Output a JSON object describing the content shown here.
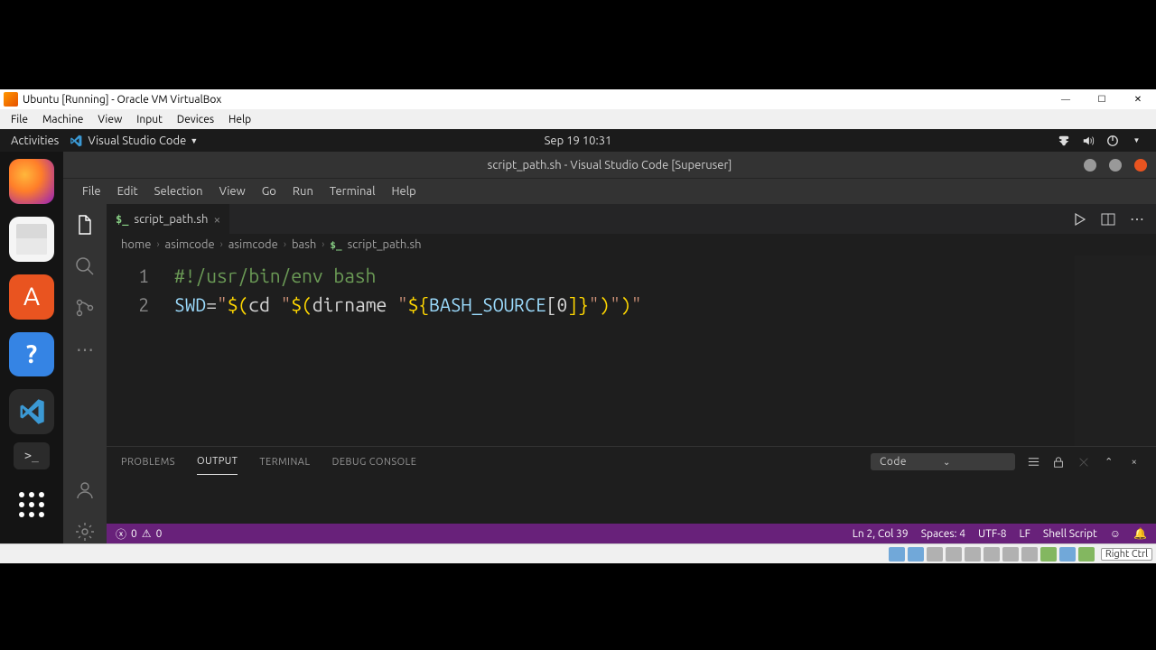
{
  "virtualbox": {
    "title": "Ubuntu [Running] - Oracle VM VirtualBox",
    "menu": [
      "File",
      "Machine",
      "View",
      "Input",
      "Devices",
      "Help"
    ],
    "hostkey": "Right Ctrl"
  },
  "gnome": {
    "activities": "Activities",
    "app_menu": "Visual Studio Code",
    "clock": "Sep 19  10:31"
  },
  "vscode": {
    "title": "script_path.sh - Visual Studio Code [Superuser]",
    "menu": [
      "File",
      "Edit",
      "Selection",
      "View",
      "Go",
      "Run",
      "Terminal",
      "Help"
    ],
    "tab": {
      "icon": "$_",
      "name": "script_path.sh"
    },
    "breadcrumb": [
      "home",
      "asimcode",
      "asimcode",
      "bash",
      "script_path.sh"
    ],
    "lines": {
      "l1": "#!/usr/bin/env bash",
      "l2_var": "SWD",
      "l2_eq": "=",
      "l2_q1": "\"",
      "l2_d1": "$(",
      "l2_cd": "cd ",
      "l2_q2": "\"",
      "l2_d2": "$(",
      "l2_dir": "dirname ",
      "l2_q3": "\"",
      "l2_bs1": "${",
      "l2_bs2": "BASH_SOURCE",
      "l2_bs3": "[",
      "l2_bs4": "0",
      "l2_bs5": "]}",
      "l2_q4": "\"",
      "l2_c1": ")",
      "l2_q5": "\"",
      "l2_c2": ")",
      "l2_q6": "\""
    },
    "panel": {
      "tabs": [
        "PROBLEMS",
        "OUTPUT",
        "TERMINAL",
        "DEBUG CONSOLE"
      ],
      "active": 1,
      "selector": "Code"
    },
    "status": {
      "errors": "0",
      "warnings": "0",
      "cursor": "Ln 2, Col 39",
      "spaces": "Spaces: 4",
      "encoding": "UTF-8",
      "eol": "LF",
      "lang": "Shell Script"
    }
  }
}
